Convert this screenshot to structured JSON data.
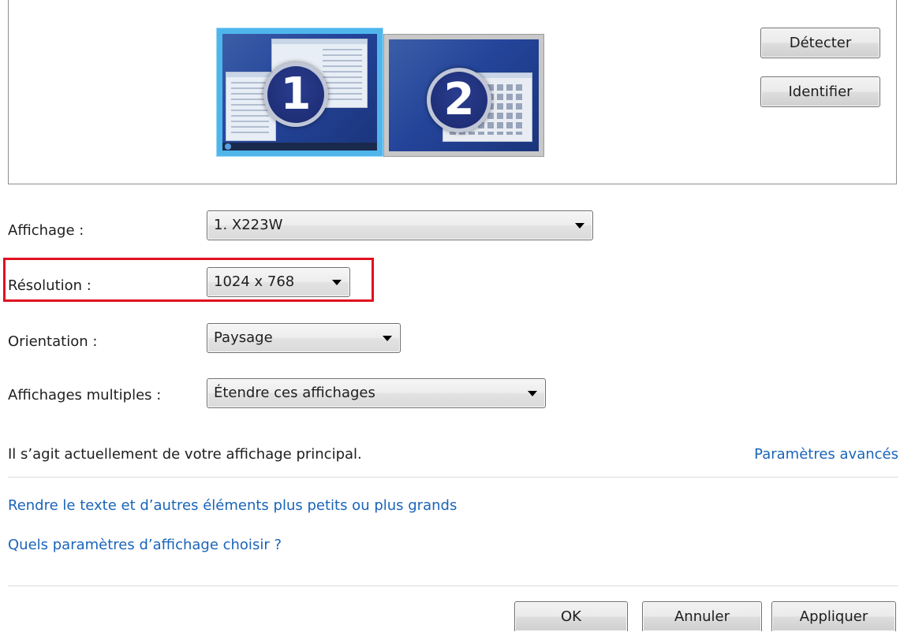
{
  "monitors": [
    {
      "number": "1",
      "selected": true
    },
    {
      "number": "2",
      "selected": false
    }
  ],
  "buttons": {
    "detect": "Détecter",
    "identify": "Identifier",
    "ok": "OK",
    "cancel": "Annuler",
    "apply": "Appliquer"
  },
  "fields": {
    "display": {
      "label": "Affichage :",
      "value": "1. X223W"
    },
    "resolution": {
      "label": "Résolution :",
      "value": "1024 x 768"
    },
    "orientation": {
      "label": "Orientation :",
      "value": "Paysage"
    },
    "multiple_displays": {
      "label": "Affichages multiples :",
      "value": "Étendre ces affichages"
    }
  },
  "status_text": "Il s’agit actuellement de votre affichage principal.",
  "links": {
    "advanced_settings": "Paramètres avancés",
    "text_size": "Rendre le texte et d’autres éléments plus petits ou plus grands",
    "which_settings": "Quels paramètres d’affichage choisir ?"
  },
  "colors": {
    "link": "#1a64b8",
    "highlight": "#e01020",
    "selected_monitor_border": "#4fb6ec"
  }
}
